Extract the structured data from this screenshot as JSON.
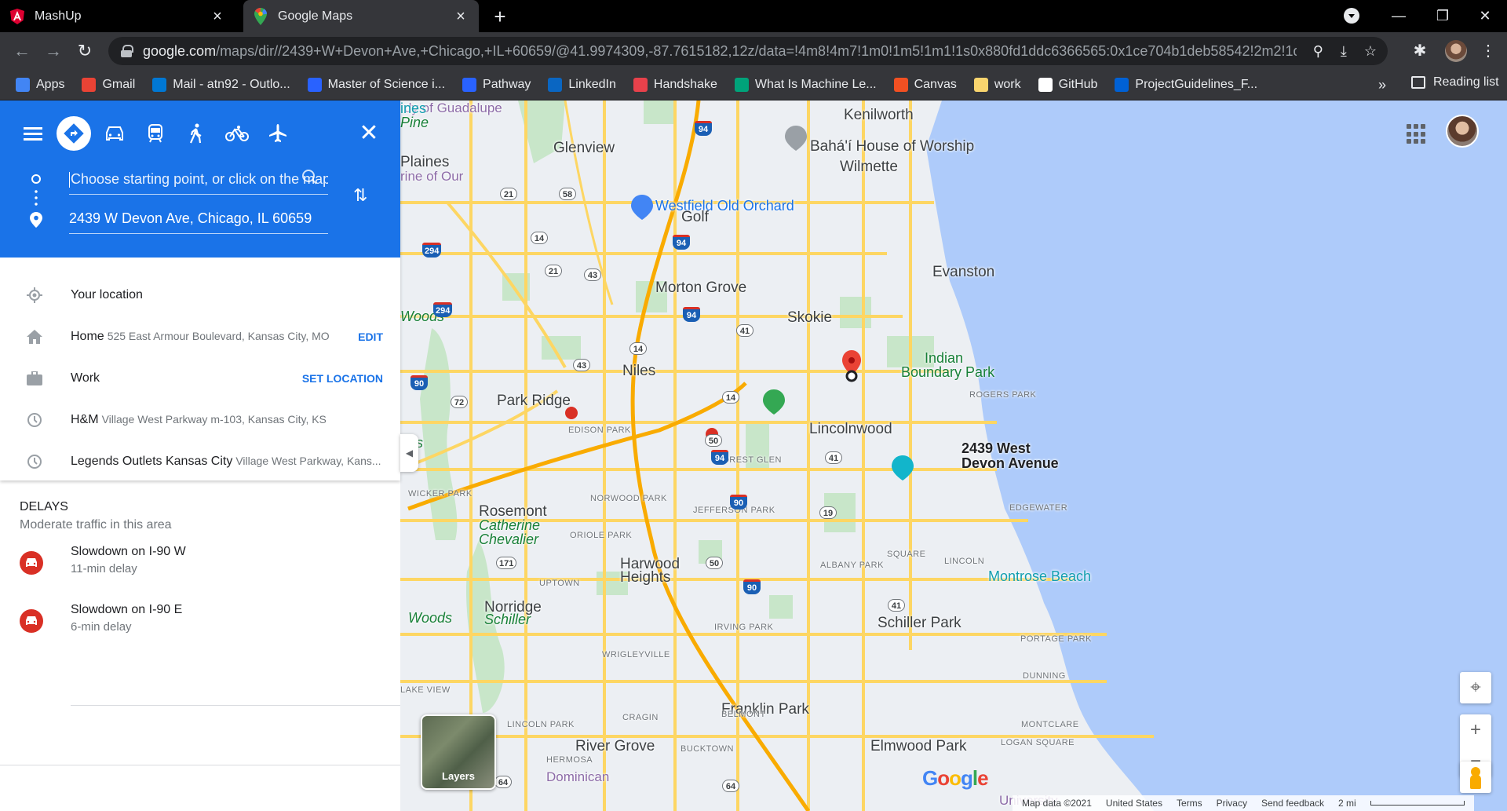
{
  "browser": {
    "tabs": [
      {
        "title": "MashUp",
        "icon": "angular-icon",
        "active": false
      },
      {
        "title": "Google Maps",
        "icon": "google-maps-icon",
        "active": true
      }
    ],
    "url_host": "google.com",
    "url_path": "/maps/dir//2439+W+Devon+Ave,+Chicago,+IL+60659/@41.9974309,-87.7615182,12z/data=!4m8!4m7!1m0!1m5!1m1!1s0x880fd1ddc6366565:0x1ce704b1deb58542!2m2!1d-87....",
    "bookmarks": [
      {
        "label": "Apps",
        "icon": "apps-grid-icon",
        "color": "#4285f4"
      },
      {
        "label": "Gmail",
        "icon": "gmail-icon",
        "color": "#ea4335"
      },
      {
        "label": "Mail - atn92 - Outlo...",
        "icon": "outlook-icon",
        "color": "#0078d4"
      },
      {
        "label": "Master of Science i...",
        "icon": "bookmark-icon",
        "color": "#2962ff"
      },
      {
        "label": "Pathway",
        "icon": "bookmark-icon",
        "color": "#2962ff"
      },
      {
        "label": "LinkedIn",
        "icon": "linkedin-icon",
        "color": "#0a66c2"
      },
      {
        "label": "Handshake",
        "icon": "handshake-icon",
        "color": "#e8414b"
      },
      {
        "label": "What Is Machine Le...",
        "icon": "bookmark-icon",
        "color": "#00a37a"
      },
      {
        "label": "Canvas",
        "icon": "microsoft-icon",
        "color": "#f25022"
      },
      {
        "label": "work",
        "icon": "folder-icon",
        "color": "#f9d56e"
      },
      {
        "label": "GitHub",
        "icon": "github-icon",
        "color": "#ffffff"
      },
      {
        "label": "ProjectGuidelines_F...",
        "icon": "box-icon",
        "color": "#0061d5"
      }
    ],
    "bookmarks_more": "»",
    "reading_list": "Reading list"
  },
  "directions": {
    "start_placeholder": "Choose starting point, or click on the map...",
    "destination": "2439 W Devon Ave, Chicago, IL 60659",
    "modes": [
      "directions",
      "car",
      "transit",
      "walking",
      "cycling",
      "flight"
    ]
  },
  "places": [
    {
      "icon": "my-location-icon",
      "title": "Your location",
      "sub": "",
      "action": ""
    },
    {
      "icon": "home-icon",
      "title": "Home",
      "sub": "525 East Armour Boulevard, Kansas City, MO",
      "action": "EDIT"
    },
    {
      "icon": "work-icon",
      "title": "Work",
      "sub": "",
      "action": "SET LOCATION"
    },
    {
      "icon": "history-icon",
      "title": "H&M",
      "sub": "Village West Parkway m-103, Kansas City, KS",
      "action": ""
    },
    {
      "icon": "history-icon",
      "title": "Legends Outlets Kansas City",
      "sub": "Village West Parkway, Kans...",
      "action": ""
    }
  ],
  "delays": {
    "heading": "DELAYS",
    "subheading": "Moderate traffic in this area",
    "items": [
      {
        "title": "Slowdown on I-90 W",
        "sub": "11-min delay"
      },
      {
        "title": "Slowdown on I-90 E",
        "sub": "6-min delay"
      }
    ]
  },
  "map": {
    "pin_label_line1": "2439 West",
    "pin_label_line2": "Devon Avenue",
    "labels": [
      {
        "text": "Kenilworth",
        "cls": "city"
      },
      {
        "text": "Bahá'í House of Worship",
        "cls": "city"
      },
      {
        "text": "Wilmette",
        "cls": "city"
      },
      {
        "text": "Glenview",
        "cls": "city"
      },
      {
        "text": "Westfield Old Orchard",
        "cls": "blue"
      },
      {
        "text": "Golf",
        "cls": "city"
      },
      {
        "text": "Evanston",
        "cls": "city"
      },
      {
        "text": "Morton Grove",
        "cls": "city"
      },
      {
        "text": "Skokie",
        "cls": "city"
      },
      {
        "text": "Indian",
        "cls": "green"
      },
      {
        "text": "Boundary Park",
        "cls": "green"
      },
      {
        "text": "ROGERS PARK",
        "cls": "small"
      },
      {
        "text": "Niles",
        "cls": "city"
      },
      {
        "text": "Park Ridge",
        "cls": "city"
      },
      {
        "text": "Lincolnwood",
        "cls": "city"
      },
      {
        "text": "EDISON PARK",
        "cls": "small"
      },
      {
        "text": "FOREST GLEN",
        "cls": "small"
      },
      {
        "text": "NORWOOD PARK",
        "cls": "small"
      },
      {
        "text": "JEFFERSON PARK",
        "cls": "small"
      },
      {
        "text": "EDGEWATER",
        "cls": "small"
      },
      {
        "text": "ORIOLE PARK",
        "cls": "small"
      },
      {
        "text": "Harwood",
        "cls": "city"
      },
      {
        "text": "Heights",
        "cls": "city"
      },
      {
        "text": "ALBANY PARK",
        "cls": "small"
      },
      {
        "text": "LINCOLN",
        "cls": "small"
      },
      {
        "text": "SQUARE",
        "cls": "small"
      },
      {
        "text": "Montrose Beach",
        "cls": "teal"
      },
      {
        "text": "UPTOWN",
        "cls": "small"
      },
      {
        "text": "Norridge",
        "cls": "city"
      },
      {
        "text": "Schiller",
        "cls": "green-it"
      },
      {
        "text": "Woods",
        "cls": "green-it"
      },
      {
        "text": "Schiller Park",
        "cls": "city"
      },
      {
        "text": "IRVING PARK",
        "cls": "small"
      },
      {
        "text": "PORTAGE PARK",
        "cls": "small"
      },
      {
        "text": "WRIGLEYVILLE",
        "cls": "small"
      },
      {
        "text": "DUNNING",
        "cls": "small"
      },
      {
        "text": "LAKE VIEW",
        "cls": "small"
      },
      {
        "text": "Franklin Park",
        "cls": "city"
      },
      {
        "text": "BELMONT",
        "cls": "small"
      },
      {
        "text": "CRAGIN",
        "cls": "small"
      },
      {
        "text": "MONTCLARE",
        "cls": "small"
      },
      {
        "text": "LINCOLN PARK",
        "cls": "small"
      },
      {
        "text": "River Grove",
        "cls": "city"
      },
      {
        "text": "Elmwood Park",
        "cls": "city"
      },
      {
        "text": "LOGAN SQUARE",
        "cls": "small"
      },
      {
        "text": "BUCKTOWN",
        "cls": "small"
      },
      {
        "text": "HERMOSA",
        "cls": "small"
      },
      {
        "text": "Dominican",
        "cls": "purple"
      },
      {
        "text": "University",
        "cls": "purple"
      },
      {
        "text": "WICKER PARK",
        "cls": "small"
      },
      {
        "text": "Rosemont",
        "cls": "city"
      },
      {
        "text": "Catherine",
        "cls": "green-it"
      },
      {
        "text": "Chevalier",
        "cls": "green-it"
      },
      {
        "text": "Woods",
        "cls": "green-it"
      },
      {
        "text": "Plaines",
        "cls": "city"
      },
      {
        "text": "rine of Our",
        "cls": "purple"
      },
      {
        "text": "dy of Guadalupe",
        "cls": "purple"
      },
      {
        "text": "Pine",
        "cls": "green-it"
      },
      {
        "text": "ods",
        "cls": "green-it"
      },
      {
        "text": "ines",
        "cls": "teal"
      }
    ],
    "shields": [
      "94",
      "21",
      "58",
      "14",
      "94",
      "294",
      "21",
      "43",
      "294",
      "94",
      "41",
      "14",
      "43",
      "90",
      "72",
      "14",
      "50",
      "94",
      "41",
      "90",
      "19",
      "171",
      "50",
      "90",
      "41",
      "64",
      "64"
    ],
    "layers_label": "Layers",
    "footer": [
      "Map data ©2021",
      "United States",
      "Terms",
      "Privacy",
      "Send feedback",
      "2 mi"
    ],
    "zoom_in": "+",
    "zoom_out": "−"
  },
  "colors": {
    "accent": "#1a73e8",
    "traffic_red": "#d93025",
    "water": "#aecbfa",
    "park": "#c8e6c9",
    "road": "#fdd663"
  }
}
